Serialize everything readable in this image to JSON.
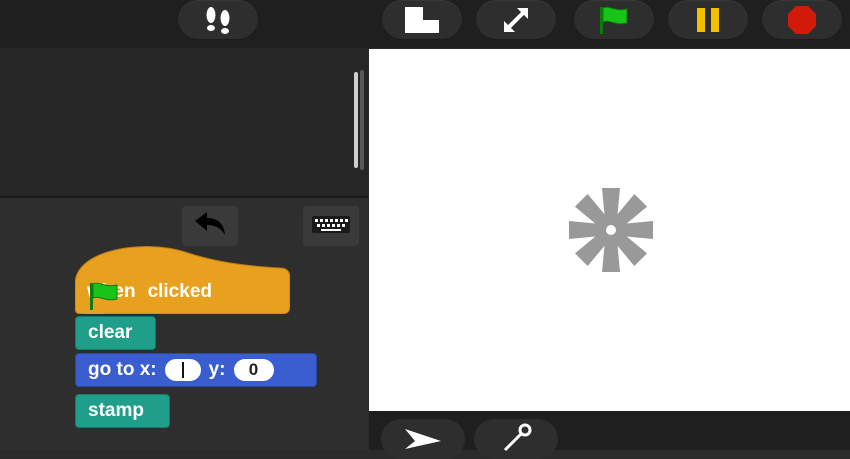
{
  "colors": {
    "green_flag": "#18c418",
    "pause": "#f2c200",
    "stop": "#d11a0a",
    "hat_block": "#e8a01f",
    "looks_block": "#1f9e8a",
    "motion_block": "#3a5ecf"
  },
  "toolbar": {
    "buttons": [
      {
        "name": "footprints-button",
        "icon": "footprints-icon"
      },
      {
        "name": "stage-size-button",
        "icon": "stage-size-icon"
      },
      {
        "name": "fullscreen-button",
        "icon": "expand-arrows-icon"
      },
      {
        "name": "green-flag-button",
        "icon": "green-flag-icon"
      },
      {
        "name": "pause-button",
        "icon": "pause-icon"
      },
      {
        "name": "stop-button",
        "icon": "stop-octagon-icon"
      }
    ]
  },
  "scripts": {
    "hat": {
      "before": "when",
      "after": "clicked"
    },
    "clear": "clear",
    "goto": {
      "prefix": "go to x:",
      "y_label": "y:",
      "x_value": "",
      "y_value": "0"
    },
    "stamp": "stamp"
  },
  "corral": {
    "buttons": [
      {
        "name": "turtle-sprite-button",
        "icon": "arrow-turtle-icon"
      },
      {
        "name": "paint-brush-button",
        "icon": "paintbrush-icon"
      }
    ]
  }
}
